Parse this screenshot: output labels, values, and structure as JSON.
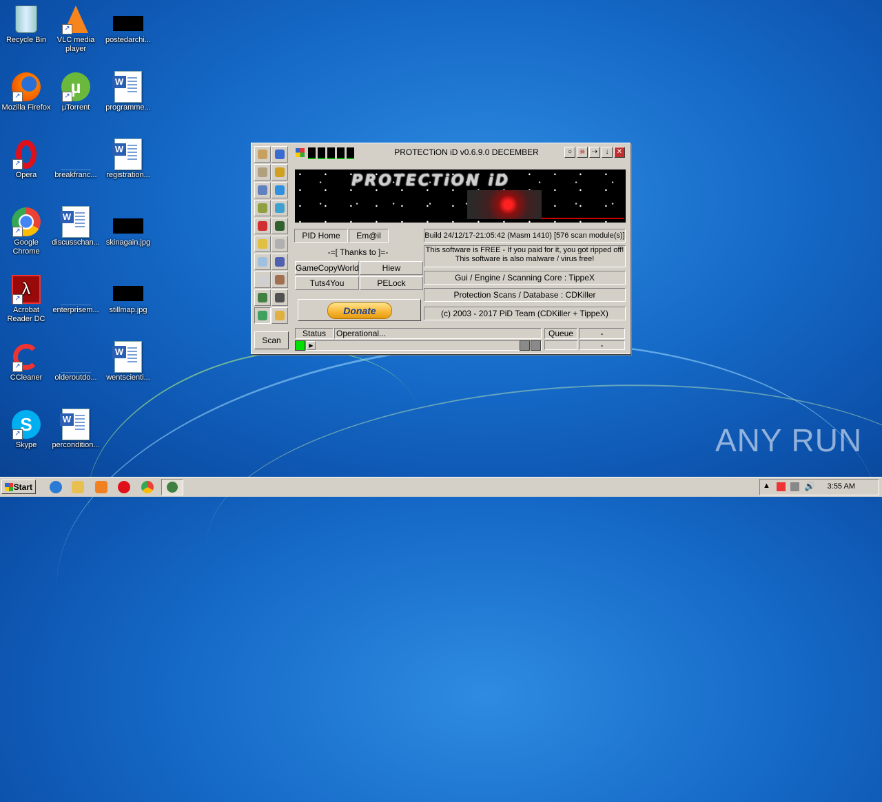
{
  "desktop": {
    "icons": [
      {
        "label": "Recycle Bin",
        "icon": "recycle-bin-icon"
      },
      {
        "label": "VLC media player",
        "icon": "vlc-icon"
      },
      {
        "label": "postedarchi...",
        "icon": "file-icon"
      },
      {
        "label": "Mozilla Firefox",
        "icon": "firefox-icon"
      },
      {
        "label": "µTorrent",
        "icon": "utorrent-icon"
      },
      {
        "label": "programme...",
        "icon": "word-document-icon"
      },
      {
        "label": "Opera",
        "icon": "opera-icon"
      },
      {
        "label": "breakfranc...",
        "icon": "file-icon"
      },
      {
        "label": "registration...",
        "icon": "word-document-icon"
      },
      {
        "label": "Google Chrome",
        "icon": "chrome-icon"
      },
      {
        "label": "discusschan...",
        "icon": "word-document-icon"
      },
      {
        "label": "skinagain.jpg",
        "icon": "image-file-icon"
      },
      {
        "label": "Acrobat Reader DC",
        "icon": "acrobat-icon"
      },
      {
        "label": "enterprisem...",
        "icon": "file-icon"
      },
      {
        "label": "stillmap.jpg",
        "icon": "image-file-icon"
      },
      {
        "label": "CCleaner",
        "icon": "ccleaner-icon"
      },
      {
        "label": "olderoutdo...",
        "icon": "file-icon"
      },
      {
        "label": "wentscienti...",
        "icon": "word-document-icon"
      },
      {
        "label": "Skype",
        "icon": "skype-icon"
      },
      {
        "label": "percondition...",
        "icon": "word-document-icon"
      }
    ]
  },
  "window": {
    "title": "PROTECTiON iD v0.6.9.0 DECEMBER",
    "banner_logo": "PROTECTiON iD",
    "buttons": {
      "pid_home": "PID Home",
      "email": "Em@il",
      "thanks": "-=[ Thanks to ]=-",
      "gamecopyworld": "GameCopyWorld",
      "hiew": "Hiew",
      "tuts4you": "Tuts4You",
      "pelock": "PELock",
      "donate": "Donate",
      "scan": "Scan"
    },
    "info": {
      "build": "Build 24/12/17-21:05:42 (Masm 1410) [576 scan module(s)]",
      "free_line1": "This software is FREE - If you paid for it, you got ripped off!",
      "free_line2": "This software is also malware / virus free!",
      "gui": "Gui / Engine / Scanning Core : TippeX",
      "protection": "Protection Scans / Database : CDKiller",
      "copyright": "(c) 2003 - 2017 PiD Team (CDKiller + TippeX)"
    },
    "status": {
      "label": "Status",
      "value": "Operational...",
      "queue_label": "Queue",
      "queue_value": "-",
      "second_value": "-"
    }
  },
  "taskbar": {
    "start": "Start",
    "clock": "3:55 AM"
  },
  "watermark": "ANY RUN"
}
